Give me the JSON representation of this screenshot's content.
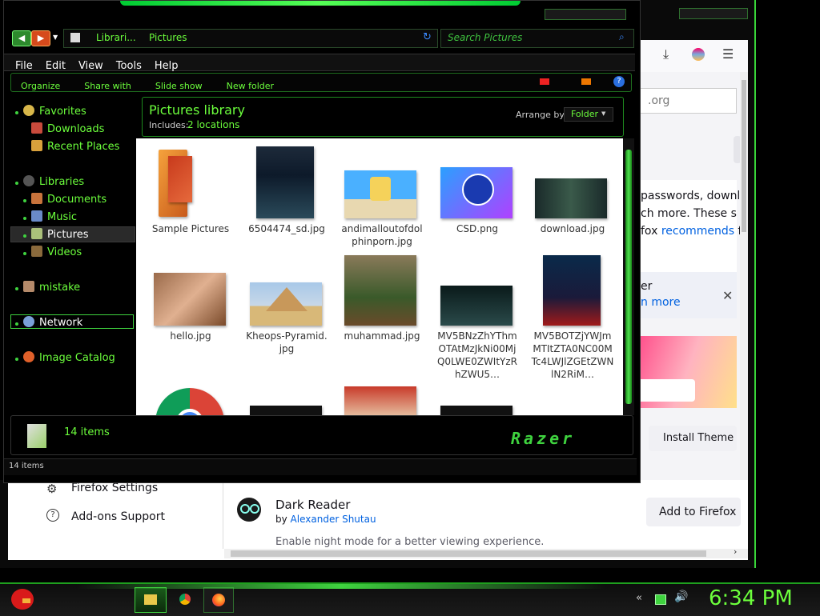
{
  "explorer": {
    "path": {
      "part1": "Librari...",
      "part2": "Pictures"
    },
    "search_placeholder": "Search Pictures",
    "menu": [
      "File",
      "Edit",
      "View",
      "Tools",
      "Help"
    ],
    "commands": [
      "Organize",
      "Share with",
      "Slide show",
      "New folder"
    ],
    "library_title": "Pictures library",
    "includes_label": "Includes:",
    "includes_value": "2 locations",
    "arrange_label": "Arrange by:",
    "arrange_value": "Folder",
    "nav": {
      "favorites": "Favorites",
      "downloads": "Downloads",
      "recent": "Recent Places",
      "libraries": "Libraries",
      "documents": "Documents",
      "music": "Music",
      "pictures": "Pictures",
      "videos": "Videos",
      "mistake": "mistake",
      "network": "Network",
      "image_catalog": "Image Catalog"
    },
    "files": [
      {
        "name": "Sample Pictures"
      },
      {
        "name": "6504474_sd.jpg"
      },
      {
        "name": "andimalloutofdolphinporn.jpg"
      },
      {
        "name": "CSD.png"
      },
      {
        "name": "download.jpg"
      },
      {
        "name": "hello.jpg"
      },
      {
        "name": "Kheops-Pyramid.jpg"
      },
      {
        "name": "muhammad.jpg"
      },
      {
        "name": "MV5BNzZhYThmOTAtMzJkNi00MjQ0LWE0ZWItYzRhZWU5…"
      },
      {
        "name": "MV5BOTZjYWJmMTItZTA0NC00MTc4LWJlZGEtZWNlN2RiM…"
      }
    ],
    "status_count": "14 items",
    "status_bar": "14 items",
    "brand": "Razer"
  },
  "firefox": {
    "url_fragment": ".org",
    "text1": "passwords, downl",
    "text2": "ch more. These s",
    "text3_pre": "fox ",
    "text3_link": "recommends",
    "text3_post": " f",
    "card_text1": "er",
    "card_link": "n more",
    "install_theme": "Install Theme",
    "settings": "Firefox Settings",
    "addons_support": "Add-ons Support",
    "ext_name": "Dark Reader",
    "ext_by": "by",
    "ext_author": "Alexander Shutau",
    "ext_desc": "Enable night mode for a better viewing experience.",
    "add_button": "Add to Firefox"
  },
  "taskbar": {
    "clock": "6:34 PM"
  },
  "colors": {
    "accent": "#6cff3c",
    "firefox_link": "#0061e0"
  }
}
